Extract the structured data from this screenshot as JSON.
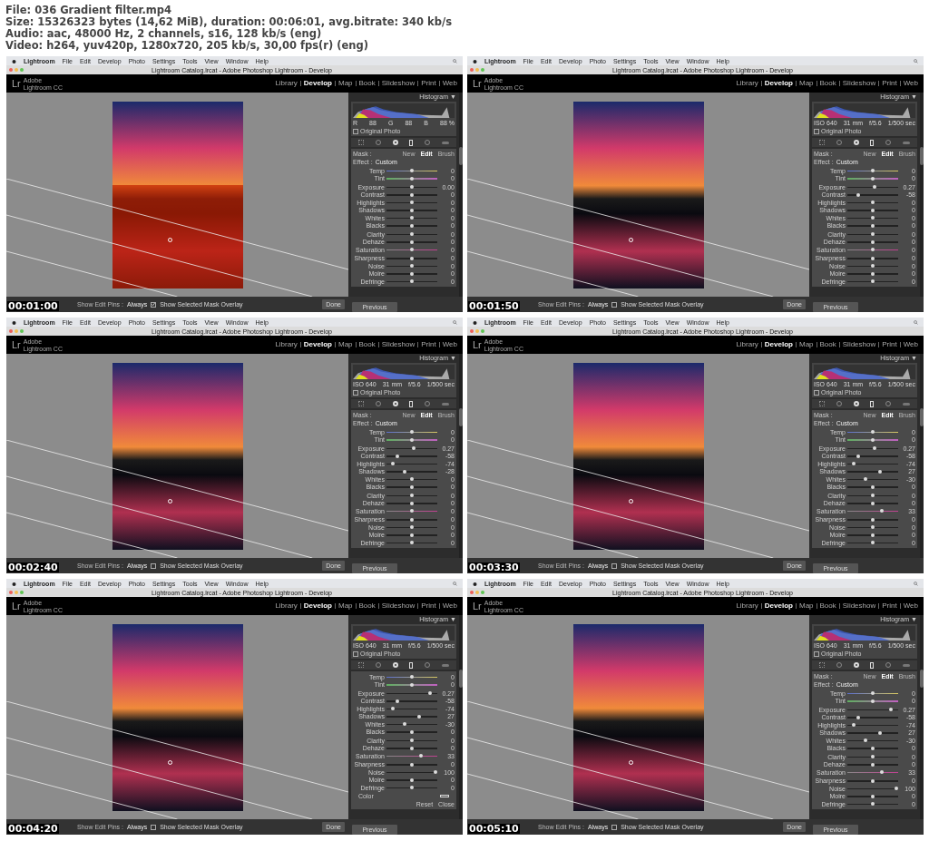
{
  "header": [
    "File: 036 Gradient filter.mp4",
    "Size: 15326323 bytes (14,62 MiB), duration: 00:06:01, avg.bitrate: 340 kb/s",
    "Audio: aac, 48000 Hz, 2 channels, s16, 128 kb/s (eng)",
    "Video: h264, yuv420p, 1280x720, 205 kb/s, 30,00 fps(r) (eng)"
  ],
  "frames": [
    {
      "timestamp": "00:01:00",
      "menu": [
        "Lightroom",
        "File",
        "Edit",
        "Develop",
        "Photo",
        "Settings",
        "Tools",
        "View",
        "Window",
        "Help"
      ],
      "window_title": "Lightroom Catalog.lrcat - Adobe Photoshop Lightroom - Develop",
      "logo": {
        "mark": "Lr",
        "brand": "Adobe",
        "product": "Lightroom CC"
      },
      "modules": [
        {
          "label": "Library",
          "selected": false
        },
        {
          "label": "Develop",
          "selected": true
        },
        {
          "label": "Map",
          "selected": false
        },
        {
          "label": "Book",
          "selected": false
        },
        {
          "label": "Slideshow",
          "selected": false
        },
        {
          "label": "Print",
          "selected": false
        },
        {
          "label": "Web",
          "selected": false
        }
      ],
      "panel_title": "Histogram",
      "panel_caret": "▼",
      "histogram_info": [
        "R",
        "88",
        "G",
        "88",
        "B",
        "88 %"
      ],
      "original_photo": {
        "label": "Original Photo",
        "checked": false
      },
      "mask": {
        "label": "Mask :",
        "tabs": [
          {
            "label": "New",
            "selected": false
          },
          {
            "label": "Edit",
            "selected": true
          },
          {
            "label": "Brush",
            "selected": false
          }
        ]
      },
      "effect": {
        "label": "Effect :",
        "value": "Custom"
      },
      "slider_groups": [
        [
          {
            "kind": "temp",
            "label": "Temp",
            "level": 0.5,
            "value": "0"
          },
          {
            "kind": "tint",
            "label": "Tint",
            "level": 0.5,
            "value": "0"
          }
        ],
        [
          {
            "kind": "plain",
            "label": "Exposure",
            "level": 0.5,
            "value": "0.00"
          },
          {
            "kind": "plain",
            "label": "Contrast",
            "level": 0.5,
            "value": "0"
          },
          {
            "kind": "plain",
            "label": "Highlights",
            "level": 0.5,
            "value": "0"
          },
          {
            "kind": "plain",
            "label": "Shadows",
            "level": 0.5,
            "value": "0"
          },
          {
            "kind": "plain",
            "label": "Whites",
            "level": 0.5,
            "value": "0"
          },
          {
            "kind": "plain",
            "label": "Blacks",
            "level": 0.5,
            "value": "0"
          }
        ],
        [
          {
            "kind": "plain",
            "label": "Clarity",
            "level": 0.5,
            "value": "0"
          },
          {
            "kind": "plain",
            "label": "Dehaze",
            "level": 0.5,
            "value": "0"
          },
          {
            "kind": "saturation",
            "label": "Saturation",
            "level": 0.5,
            "value": "0"
          }
        ],
        [
          {
            "kind": "plain",
            "label": "Sharpness",
            "level": 0.5,
            "value": "0"
          },
          {
            "kind": "plain",
            "label": "Noise",
            "level": 0.5,
            "value": "0"
          },
          {
            "kind": "plain",
            "label": "Moire",
            "level": 0.5,
            "value": "0"
          },
          {
            "kind": "plain",
            "label": "Defringe",
            "level": 0.5,
            "value": "0"
          }
        ]
      ],
      "toolbar": {
        "pins_label": "Show Edit Pins :",
        "pins_value": "Always",
        "overlay": {
          "label": "Show Selected Mask Overlay",
          "checked": true
        },
        "done": "Done",
        "previous": "Previous"
      }
    },
    {
      "timestamp": "00:01:50",
      "menu": [
        "Lightroom",
        "File",
        "Edit",
        "Develop",
        "Photo",
        "Settings",
        "Tools",
        "View",
        "Window",
        "Help"
      ],
      "window_title": "Lightroom Catalog.lrcat - Adobe Photoshop Lightroom - Develop",
      "logo": {
        "mark": "Lr",
        "brand": "Adobe",
        "product": "Lightroom CC"
      },
      "modules": [
        {
          "label": "Library",
          "selected": false
        },
        {
          "label": "Develop",
          "selected": true
        },
        {
          "label": "Map",
          "selected": false
        },
        {
          "label": "Book",
          "selected": false
        },
        {
          "label": "Slideshow",
          "selected": false
        },
        {
          "label": "Print",
          "selected": false
        },
        {
          "label": "Web",
          "selected": false
        }
      ],
      "panel_title": "Histogram",
      "panel_caret": "▼",
      "histogram_info": [
        "ISO 640",
        "31 mm",
        "f/5.6",
        "1/500 sec"
      ],
      "original_photo": {
        "label": "Original Photo",
        "checked": false
      },
      "mask": {
        "label": "Mask :",
        "tabs": [
          {
            "label": "New",
            "selected": false
          },
          {
            "label": "Edit",
            "selected": true
          },
          {
            "label": "Brush",
            "selected": false
          }
        ]
      },
      "effect": {
        "label": "Effect :",
        "value": "Custom"
      },
      "slider_groups": [
        [
          {
            "kind": "temp",
            "label": "Temp",
            "level": 0.5,
            "value": "0"
          },
          {
            "kind": "tint",
            "label": "Tint",
            "level": 0.5,
            "value": "0"
          }
        ],
        [
          {
            "kind": "plain",
            "label": "Exposure",
            "level": 0.53,
            "value": "0.27"
          },
          {
            "kind": "plain",
            "label": "Contrast",
            "level": 0.21,
            "value": "-58"
          },
          {
            "kind": "plain",
            "label": "Highlights",
            "level": 0.5,
            "value": "0"
          },
          {
            "kind": "plain",
            "label": "Shadows",
            "level": 0.5,
            "value": "0"
          },
          {
            "kind": "plain",
            "label": "Whites",
            "level": 0.5,
            "value": "0"
          },
          {
            "kind": "plain",
            "label": "Blacks",
            "level": 0.5,
            "value": "0"
          }
        ],
        [
          {
            "kind": "plain",
            "label": "Clarity",
            "level": 0.5,
            "value": "0"
          },
          {
            "kind": "plain",
            "label": "Dehaze",
            "level": 0.5,
            "value": "0"
          },
          {
            "kind": "saturation",
            "label": "Saturation",
            "level": 0.5,
            "value": "0"
          }
        ],
        [
          {
            "kind": "plain",
            "label": "Sharpness",
            "level": 0.5,
            "value": "0"
          },
          {
            "kind": "plain",
            "label": "Noise",
            "level": 0.5,
            "value": "0"
          },
          {
            "kind": "plain",
            "label": "Moire",
            "level": 0.5,
            "value": "0"
          },
          {
            "kind": "plain",
            "label": "Defringe",
            "level": 0.5,
            "value": "0"
          }
        ]
      ],
      "toolbar": {
        "pins_label": "Show Edit Pins :",
        "pins_value": "Always",
        "overlay": {
          "label": "Show Selected Mask Overlay",
          "checked": false
        },
        "done": "Done",
        "previous": "Previous"
      }
    },
    {
      "timestamp": "00:02:40",
      "menu": [
        "Lightroom",
        "File",
        "Edit",
        "Develop",
        "Photo",
        "Settings",
        "Tools",
        "View",
        "Window",
        "Help"
      ],
      "window_title": "Lightroom Catalog.lrcat - Adobe Photoshop Lightroom - Develop",
      "logo": {
        "mark": "Lr",
        "brand": "Adobe",
        "product": "Lightroom CC"
      },
      "modules": [
        {
          "label": "Library",
          "selected": false
        },
        {
          "label": "Develop",
          "selected": true
        },
        {
          "label": "Map",
          "selected": false
        },
        {
          "label": "Book",
          "selected": false
        },
        {
          "label": "Slideshow",
          "selected": false
        },
        {
          "label": "Print",
          "selected": false
        },
        {
          "label": "Web",
          "selected": false
        }
      ],
      "panel_title": "Histogram",
      "panel_caret": "▼",
      "histogram_info": [
        "ISO 640",
        "31 mm",
        "f/5.6",
        "1/500 sec"
      ],
      "original_photo": {
        "label": "Original Photo",
        "checked": false
      },
      "mask": {
        "label": "Mask :",
        "tabs": [
          {
            "label": "New",
            "selected": false
          },
          {
            "label": "Edit",
            "selected": true
          },
          {
            "label": "Brush",
            "selected": false
          }
        ]
      },
      "effect": {
        "label": "Effect :",
        "value": "Custom"
      },
      "slider_groups": [
        [
          {
            "kind": "temp",
            "label": "Temp",
            "level": 0.5,
            "value": "0"
          },
          {
            "kind": "tint",
            "label": "Tint",
            "level": 0.5,
            "value": "0"
          }
        ],
        [
          {
            "kind": "plain",
            "label": "Exposure",
            "level": 0.53,
            "value": "0.27"
          },
          {
            "kind": "plain",
            "label": "Contrast",
            "level": 0.21,
            "value": "-58"
          },
          {
            "kind": "plain",
            "label": "Highlights",
            "level": 0.13,
            "value": "-74"
          },
          {
            "kind": "plain",
            "label": "Shadows",
            "level": 0.36,
            "value": "-28"
          },
          {
            "kind": "plain",
            "label": "Whites",
            "level": 0.5,
            "value": "0"
          },
          {
            "kind": "plain",
            "label": "Blacks",
            "level": 0.5,
            "value": "0"
          }
        ],
        [
          {
            "kind": "plain",
            "label": "Clarity",
            "level": 0.5,
            "value": "0"
          },
          {
            "kind": "plain",
            "label": "Dehaze",
            "level": 0.5,
            "value": "0"
          },
          {
            "kind": "saturation",
            "label": "Saturation",
            "level": 0.5,
            "value": "0"
          }
        ],
        [
          {
            "kind": "plain",
            "label": "Sharpness",
            "level": 0.5,
            "value": "0"
          },
          {
            "kind": "plain",
            "label": "Noise",
            "level": 0.5,
            "value": "0"
          },
          {
            "kind": "plain",
            "label": "Moire",
            "level": 0.5,
            "value": "0"
          },
          {
            "kind": "plain",
            "label": "Defringe",
            "level": 0.5,
            "value": "0"
          }
        ]
      ],
      "toolbar": {
        "pins_label": "Show Edit Pins :",
        "pins_value": "Always",
        "overlay": {
          "label": "Show Selected Mask Overlay",
          "checked": false
        },
        "done": "Done",
        "previous": "Previous"
      }
    },
    {
      "timestamp": "00:03:30",
      "menu": [
        "Lightroom",
        "File",
        "Edit",
        "Develop",
        "Photo",
        "Settings",
        "Tools",
        "View",
        "Window",
        "Help"
      ],
      "window_title": "Lightroom Catalog.lrcat - Adobe Photoshop Lightroom - Develop",
      "logo": {
        "mark": "Lr",
        "brand": "Adobe",
        "product": "Lightroom CC"
      },
      "modules": [
        {
          "label": "Library",
          "selected": false
        },
        {
          "label": "Develop",
          "selected": true
        },
        {
          "label": "Map",
          "selected": false
        },
        {
          "label": "Book",
          "selected": false
        },
        {
          "label": "Slideshow",
          "selected": false
        },
        {
          "label": "Print",
          "selected": false
        },
        {
          "label": "Web",
          "selected": false
        }
      ],
      "panel_title": "Histogram",
      "panel_caret": "▼",
      "histogram_info": [
        "ISO 640",
        "31 mm",
        "f/5.6",
        "1/500 sec"
      ],
      "original_photo": {
        "label": "Original Photo",
        "checked": false
      },
      "mask": {
        "label": "Mask :",
        "tabs": [
          {
            "label": "New",
            "selected": false
          },
          {
            "label": "Edit",
            "selected": true
          },
          {
            "label": "Brush",
            "selected": false
          }
        ]
      },
      "effect": {
        "label": "Effect :",
        "value": "Custom"
      },
      "slider_groups": [
        [
          {
            "kind": "temp",
            "label": "Temp",
            "level": 0.5,
            "value": "0"
          },
          {
            "kind": "tint",
            "label": "Tint",
            "level": 0.5,
            "value": "0"
          }
        ],
        [
          {
            "kind": "plain",
            "label": "Exposure",
            "level": 0.53,
            "value": "0.27"
          },
          {
            "kind": "plain",
            "label": "Contrast",
            "level": 0.21,
            "value": "-58"
          },
          {
            "kind": "plain",
            "label": "Highlights",
            "level": 0.13,
            "value": "-74"
          },
          {
            "kind": "plain",
            "label": "Shadows",
            "level": 0.64,
            "value": "27"
          },
          {
            "kind": "plain",
            "label": "Whites",
            "level": 0.35,
            "value": "-30"
          },
          {
            "kind": "plain",
            "label": "Blacks",
            "level": 0.5,
            "value": "0"
          }
        ],
        [
          {
            "kind": "plain",
            "label": "Clarity",
            "level": 0.5,
            "value": "0"
          },
          {
            "kind": "plain",
            "label": "Dehaze",
            "level": 0.5,
            "value": "0"
          },
          {
            "kind": "saturation",
            "label": "Saturation",
            "level": 0.67,
            "value": "33"
          }
        ],
        [
          {
            "kind": "plain",
            "label": "Sharpness",
            "level": 0.5,
            "value": "0"
          },
          {
            "kind": "plain",
            "label": "Noise",
            "level": 0.5,
            "value": "0"
          },
          {
            "kind": "plain",
            "label": "Moire",
            "level": 0.5,
            "value": "0"
          },
          {
            "kind": "plain",
            "label": "Defringe",
            "level": 0.5,
            "value": "0"
          }
        ]
      ],
      "toolbar": {
        "pins_label": "Show Edit Pins :",
        "pins_value": "Always",
        "overlay": {
          "label": "Show Selected Mask Overlay",
          "checked": false
        },
        "done": "Done",
        "previous": "Previous"
      }
    },
    {
      "timestamp": "00:04:20",
      "menu": [
        "Lightroom",
        "File",
        "Edit",
        "Develop",
        "Photo",
        "Settings",
        "Tools",
        "View",
        "Window",
        "Help"
      ],
      "window_title": "Lightroom Catalog.lrcat - Adobe Photoshop Lightroom - Develop",
      "logo": {
        "mark": "Lr",
        "brand": "Adobe",
        "product": "Lightroom CC"
      },
      "modules": [
        {
          "label": "Library",
          "selected": false
        },
        {
          "label": "Develop",
          "selected": true
        },
        {
          "label": "Map",
          "selected": false
        },
        {
          "label": "Book",
          "selected": false
        },
        {
          "label": "Slideshow",
          "selected": false
        },
        {
          "label": "Print",
          "selected": false
        },
        {
          "label": "Web",
          "selected": false
        }
      ],
      "panel_title": "Histogram",
      "panel_caret": "▼",
      "histogram_info": [
        "ISO 640",
        "31 mm",
        "f/5.6",
        "1/500 sec"
      ],
      "original_photo": {
        "label": "Original Photo",
        "checked": false
      },
      "slider_groups": [
        [
          {
            "kind": "temp",
            "label": "Temp",
            "level": 0.5,
            "value": "0"
          },
          {
            "kind": "tint",
            "label": "Tint",
            "level": 0.5,
            "value": "0"
          }
        ],
        [
          {
            "kind": "plain",
            "label": "Exposure",
            "level": 0.85,
            "value": "0.27"
          },
          {
            "kind": "plain",
            "label": "Contrast",
            "level": 0.21,
            "value": "-58"
          },
          {
            "kind": "plain",
            "label": "Highlights",
            "level": 0.13,
            "value": "-74"
          },
          {
            "kind": "plain",
            "label": "Shadows",
            "level": 0.64,
            "value": "27"
          },
          {
            "kind": "plain",
            "label": "Whites",
            "level": 0.35,
            "value": "-30"
          },
          {
            "kind": "plain",
            "label": "Blacks",
            "level": 0.5,
            "value": "0"
          }
        ],
        [
          {
            "kind": "plain",
            "label": "Clarity",
            "level": 0.5,
            "value": "0"
          },
          {
            "kind": "plain",
            "label": "Dehaze",
            "level": 0.5,
            "value": "0"
          },
          {
            "kind": "saturation",
            "label": "Saturation",
            "level": 0.67,
            "value": "33"
          }
        ],
        [
          {
            "kind": "plain",
            "label": "Sharpness",
            "level": 0.5,
            "value": "0"
          },
          {
            "kind": "plain",
            "label": "Noise",
            "level": 0.97,
            "value": "100"
          },
          {
            "kind": "plain",
            "label": "Moire",
            "level": 0.5,
            "value": "0"
          },
          {
            "kind": "plain",
            "label": "Defringe",
            "level": 0.5,
            "value": "0"
          }
        ]
      ],
      "color_label": "Color",
      "panel_footer": [
        "Reset",
        "Close"
      ],
      "toolbar": {
        "pins_label": "Show Edit Pins :",
        "pins_value": "Always",
        "overlay": {
          "label": "Show Selected Mask Overlay",
          "checked": false
        },
        "done": "Done",
        "previous": "Previous"
      }
    },
    {
      "timestamp": "00:05:10",
      "menu": [
        "Lightroom",
        "File",
        "Edit",
        "Develop",
        "Photo",
        "Settings",
        "Tools",
        "View",
        "Window",
        "Help"
      ],
      "window_title": "Lightroom Catalog.lrcat - Adobe Photoshop Lightroom - Develop",
      "logo": {
        "mark": "Lr",
        "brand": "Adobe",
        "product": "Lightroom CC"
      },
      "modules": [
        {
          "label": "Library",
          "selected": false
        },
        {
          "label": "Develop",
          "selected": true
        },
        {
          "label": "Map",
          "selected": false
        },
        {
          "label": "Book",
          "selected": false
        },
        {
          "label": "Slideshow",
          "selected": false
        },
        {
          "label": "Print",
          "selected": false
        },
        {
          "label": "Web",
          "selected": false
        }
      ],
      "panel_title": "Histogram",
      "panel_caret": "▼",
      "histogram_info": [
        "ISO 640",
        "31 mm",
        "f/5.6",
        "1/500 sec"
      ],
      "original_photo": {
        "label": "Original Photo",
        "checked": false
      },
      "mask": {
        "label": "Mask :",
        "tabs": [
          {
            "label": "New",
            "selected": false
          },
          {
            "label": "Edit",
            "selected": true
          },
          {
            "label": "Brush",
            "selected": false
          }
        ]
      },
      "effect": {
        "label": "Effect :",
        "value": "Custom"
      },
      "slider_groups": [
        [
          {
            "kind": "temp",
            "label": "Temp",
            "level": 0.5,
            "value": "0"
          },
          {
            "kind": "tint",
            "label": "Tint",
            "level": 0.5,
            "value": "0"
          }
        ],
        [
          {
            "kind": "plain",
            "label": "Exposure",
            "level": 0.85,
            "value": "0.27"
          },
          {
            "kind": "plain",
            "label": "Contrast",
            "level": 0.21,
            "value": "-58"
          },
          {
            "kind": "plain",
            "label": "Highlights",
            "level": 0.13,
            "value": "-74"
          },
          {
            "kind": "plain",
            "label": "Shadows",
            "level": 0.64,
            "value": "27"
          },
          {
            "kind": "plain",
            "label": "Whites",
            "level": 0.35,
            "value": "-30"
          },
          {
            "kind": "plain",
            "label": "Blacks",
            "level": 0.5,
            "value": "0"
          }
        ],
        [
          {
            "kind": "plain",
            "label": "Clarity",
            "level": 0.5,
            "value": "0"
          },
          {
            "kind": "plain",
            "label": "Dehaze",
            "level": 0.5,
            "value": "0"
          },
          {
            "kind": "saturation",
            "label": "Saturation",
            "level": 0.67,
            "value": "33"
          }
        ],
        [
          {
            "kind": "plain",
            "label": "Sharpness",
            "level": 0.5,
            "value": "0"
          },
          {
            "kind": "plain",
            "label": "Noise",
            "level": 0.97,
            "value": "100"
          },
          {
            "kind": "plain",
            "label": "Moire",
            "level": 0.5,
            "value": "0"
          },
          {
            "kind": "plain",
            "label": "Defringe",
            "level": 0.5,
            "value": "0"
          }
        ]
      ],
      "toolbar": {
        "pins_label": "Show Edit Pins :",
        "pins_value": "Always",
        "overlay": {
          "label": "Show Selected Mask Overlay",
          "checked": false
        },
        "done": "Done",
        "previous": "Previous"
      }
    }
  ]
}
